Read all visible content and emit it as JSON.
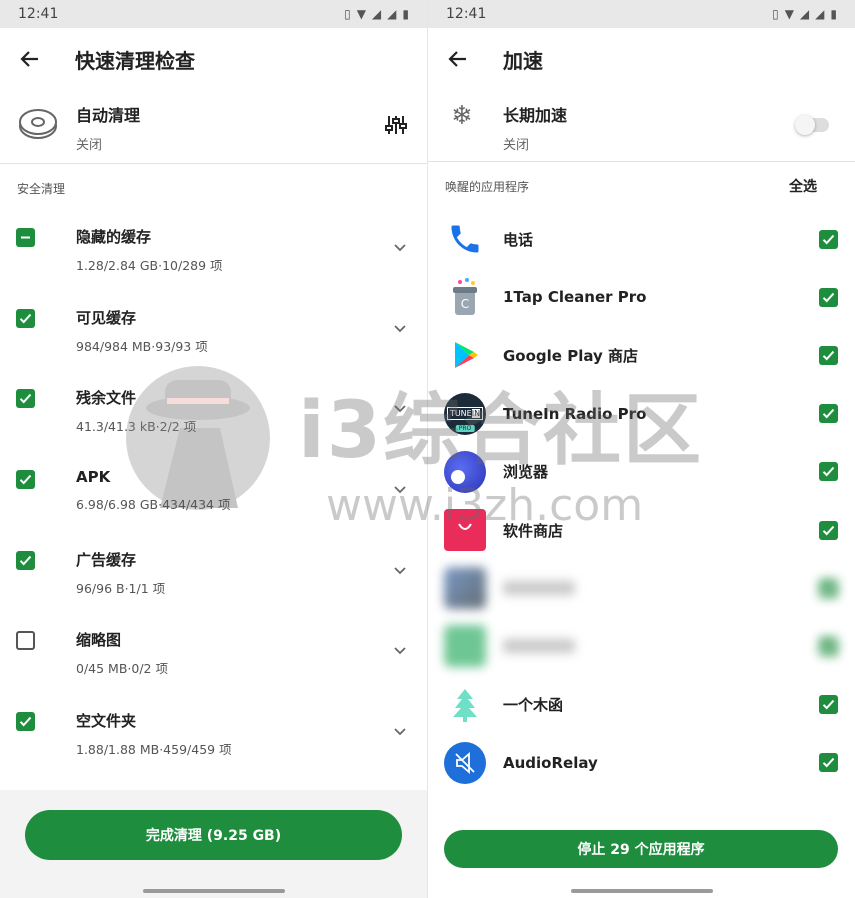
{
  "status_time": "12:41",
  "left": {
    "title": "快速清理检查",
    "auto_clean": {
      "title": "自动清理",
      "state": "关闭"
    },
    "section_label": "安全清理",
    "items": [
      {
        "title": "隐藏的缓存",
        "sub": "1.28/2.84 GB·10/289 项",
        "state": "partial"
      },
      {
        "title": "可见缓存",
        "sub": "984/984 MB·93/93 项",
        "state": "checked"
      },
      {
        "title": "残余文件",
        "sub": "41.3/41.3 kB·2/2 项",
        "state": "checked"
      },
      {
        "title": "APK",
        "sub": "6.98/6.98 GB·434/434 项",
        "state": "checked"
      },
      {
        "title": "广告缓存",
        "sub": "96/96 B·1/1 项",
        "state": "checked"
      },
      {
        "title": "缩略图",
        "sub": "0/45 MB·0/2 项",
        "state": "unchecked"
      },
      {
        "title": "空文件夹",
        "sub": "1.88/1.88 MB·459/459 项",
        "state": "checked"
      }
    ],
    "finish_button": "完成清理 (9.25 GB)"
  },
  "right": {
    "title": "加速",
    "long_boost": {
      "title": "长期加速",
      "state": "关闭",
      "enabled": false
    },
    "section_label": "唤醒的应用程序",
    "select_all": "全选",
    "apps": [
      {
        "name": "电话",
        "icon": "phone-icon",
        "checked": true,
        "blurred": false
      },
      {
        "name": "1Tap Cleaner Pro",
        "icon": "cleaner-icon",
        "checked": true,
        "blurred": false
      },
      {
        "name": "Google Play 商店",
        "icon": "play-store-icon",
        "checked": true,
        "blurred": false
      },
      {
        "name": "TuneIn Radio Pro",
        "icon": "tunein-icon",
        "checked": true,
        "blurred": false
      },
      {
        "name": "浏览器",
        "icon": "browser-icon",
        "checked": true,
        "blurred": false
      },
      {
        "name": "软件商店",
        "icon": "store-icon",
        "checked": true,
        "blurred": false
      },
      {
        "name": "",
        "icon": "blurred-app-icon",
        "checked": true,
        "blurred": true
      },
      {
        "name": "",
        "icon": "blurred-app-icon",
        "checked": true,
        "blurred": true
      },
      {
        "name": "一个木函",
        "icon": "tree-icon",
        "checked": true,
        "blurred": false
      },
      {
        "name": "AudioRelay",
        "icon": "audiorelay-icon",
        "checked": true,
        "blurred": false
      }
    ],
    "stop_button": "停止 29 个应用程序"
  },
  "watermark": {
    "text_cn": "i3综合社区",
    "text_url": "www.i3zh.com"
  },
  "colors": {
    "accent": "#1e8e3e",
    "phone_blue": "#1a73e8"
  }
}
